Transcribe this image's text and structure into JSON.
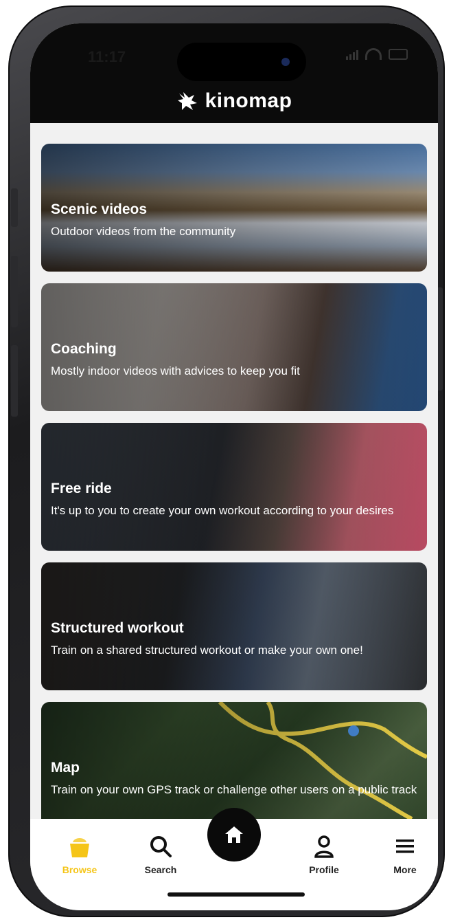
{
  "status_bar": {
    "time": "11:17"
  },
  "header": {
    "brand": "kinomap"
  },
  "cards": [
    {
      "title": "Scenic videos",
      "subtitle": "Outdoor videos from the community"
    },
    {
      "title": "Coaching",
      "subtitle": "Mostly indoor videos with advices to keep you fit"
    },
    {
      "title": "Free ride",
      "subtitle": "It's up to you to create your own workout according to your desires"
    },
    {
      "title": "Structured workout",
      "subtitle": "Train on a shared structured workout or make your own one!"
    },
    {
      "title": "Map",
      "subtitle": "Train on your own GPS track or challenge other users on a public track"
    }
  ],
  "tabbar": {
    "browse": "Browse",
    "search": "Search",
    "home_icon": "home-icon",
    "profile": "Profile",
    "more": "More"
  },
  "colors": {
    "accent": "#f5c518",
    "header_bg": "#0b0b0b",
    "tabbar_bg": "#ffffff"
  }
}
